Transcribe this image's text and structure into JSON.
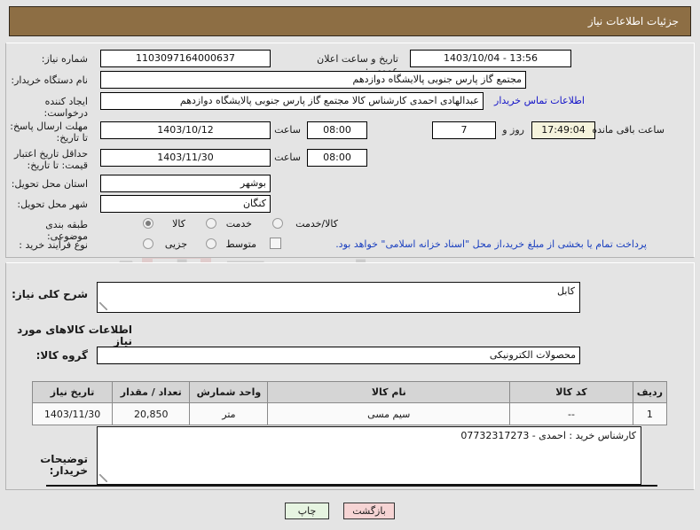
{
  "header": {
    "title": "جزئیات اطلاعات نیاز"
  },
  "watermark": {
    "text": "AriaTender.net"
  },
  "top_section": {
    "need_number_label": "شماره نیاز:",
    "need_number_value": "1103097164000637",
    "announce_datetime_label": "تاریخ و ساعت اعلان عمومی:",
    "announce_datetime_value": "13:56 - 1403/10/04",
    "buyer_org_label": "نام دستگاه خریدار:",
    "buyer_org_value": "مجتمع گاز پارس جنوبی  پالایشگاه دوازدهم",
    "buyer_org_extra_value": "",
    "request_creator_label": "ایجاد کننده درخواست:",
    "request_creator_value": "عبدالهادی احمدی کارشناس کالا مجتمع گاز پارس جنوبی  پالایشگاه دوازدهم",
    "contact_link": "اطلاعات تماس خریدار",
    "response_deadline_label": "مهلت ارسال پاسخ: تا تاریخ:",
    "response_deadline_date": "1403/10/12",
    "response_deadline_hour_label": "ساعت",
    "response_deadline_hour": "08:00",
    "days_value": "7",
    "days_unit": "روز و",
    "countdown_value": "17:49:04",
    "countdown_suffix": "ساعت باقی مانده",
    "price_validity_label": "حداقل تاریخ اعتبار قیمت: تا تاریخ:",
    "price_validity_date": "1403/11/30",
    "price_validity_hour_label": "ساعت",
    "price_validity_hour": "08:00",
    "province_label": "استان محل تحویل:",
    "province_value": "بوشهر",
    "city_label": "شهر محل تحویل:",
    "city_value": "کنگان",
    "category_label": "طبقه بندی موضوعی:",
    "category_options": [
      "کالا",
      "خدمت",
      "کالا/خدمت"
    ],
    "category_selected": "کالا",
    "process_label": "نوع فرآیند خرید :",
    "process_options": [
      "جزیی",
      "متوسط"
    ],
    "process_selected": "",
    "treasury_checkbox_checked": false,
    "treasury_note": "پرداخت تمام یا بخشی از مبلغ خرید،از محل \"اسناد خزانه اسلامی\" خواهد بود."
  },
  "middle_section": {
    "general_desc_label": "شرح کلی نیاز:",
    "general_desc_value": "کابل",
    "goods_info_heading": "اطلاعات کالاهای مورد نیاز",
    "goods_group_label": "گروه کالا:",
    "goods_group_value": "محصولات الکترونیکی",
    "table": {
      "headers": [
        "ردیف",
        "کد کالا",
        "نام کالا",
        "واحد شمارش",
        "تعداد / مقدار",
        "تاریخ نیاز"
      ],
      "rows": [
        [
          "1",
          "--",
          "سیم مسی",
          "متر",
          "20,850",
          "1403/11/30"
        ]
      ]
    },
    "buyer_notes_label": "توضیحات خریدار:",
    "buyer_notes_value": "کارشناس  خرید : احمدی - 07732317273"
  },
  "footer": {
    "back_button": "بازگشت",
    "print_button": "چاپ"
  }
}
